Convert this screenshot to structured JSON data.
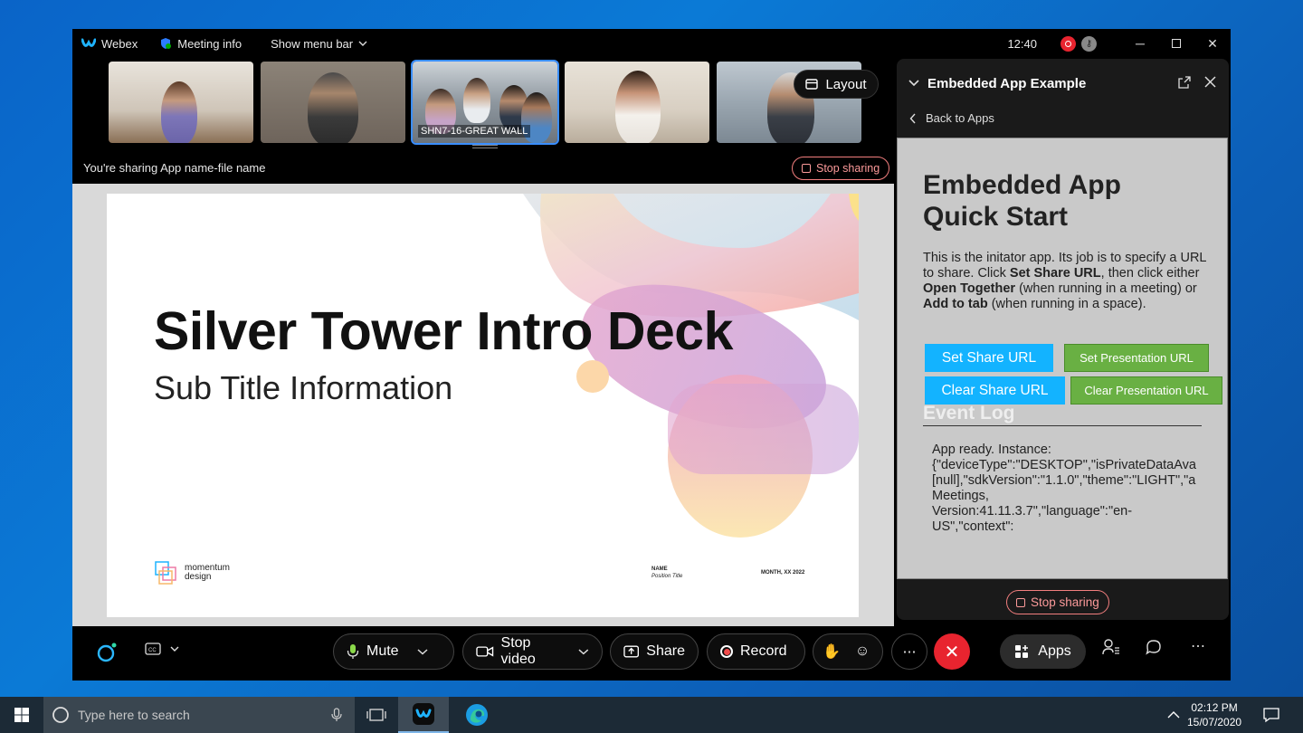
{
  "titlebar": {
    "app_name": "Webex",
    "meeting_info": "Meeting info",
    "menu_bar": "Show menu bar",
    "time": "12:40"
  },
  "participants": [
    {
      "name": ""
    },
    {
      "name": ""
    },
    {
      "name": "SHN7-16-GREAT WALL"
    },
    {
      "name": ""
    },
    {
      "name": ""
    }
  ],
  "layout_label": "Layout",
  "sharing": {
    "info": "You're sharing App name-file name",
    "stop_label": "Stop sharing"
  },
  "slide": {
    "title": "Silver Tower Intro Deck",
    "subtitle": "Sub Title Information",
    "brand_line1": "momentum",
    "brand_line2": "design",
    "name_label": "NAME",
    "position_label": "Position Title",
    "date_label": "MONTH, XX 2022"
  },
  "panel": {
    "title": "Embedded App Example",
    "back_label": "Back to Apps",
    "heading": "Embedded App Quick Start",
    "desc_part1": "This is the initator app. Its job is to specify a URL to share. Click ",
    "desc_bold1": "Set Share URL",
    "desc_part2": ", then click either ",
    "desc_bold2": "Open Together",
    "desc_part3": " (when running in a meeting) or ",
    "desc_bold3": "Add to tab",
    "desc_part4": " (when running in a space).",
    "btn_set_share": "Set Share URL",
    "btn_set_presentation": "Set Presentation URL",
    "btn_clear_share": "Clear Share URL",
    "btn_clear_presentation": "Clear Presentation URL",
    "event_log_heading": "Event Log",
    "event_log_text": "App ready. Instance:\n{\"deviceType\":\"DESKTOP\",\"isPrivateDataAva\n[null],\"sdkVersion\":\"1.1.0\",\"theme\":\"LIGHT\",\"a\nMeetings,\nVersion:41.11.3.7\",\"language\":\"en-\nUS\",\"context\":",
    "stop_label": "Stop sharing"
  },
  "toolbar": {
    "mute": "Mute",
    "stop_video": "Stop video",
    "share": "Share",
    "record": "Record",
    "apps": "Apps"
  },
  "taskbar": {
    "search_placeholder": "Type here to search",
    "time": "02:12 PM",
    "date": "15/07/2020"
  },
  "colors": {
    "accent_blue": "#13b3ff",
    "accent_green": "#69b043",
    "end_call_red": "#e8242f",
    "stop_share_pink": "#fc9a9a"
  }
}
